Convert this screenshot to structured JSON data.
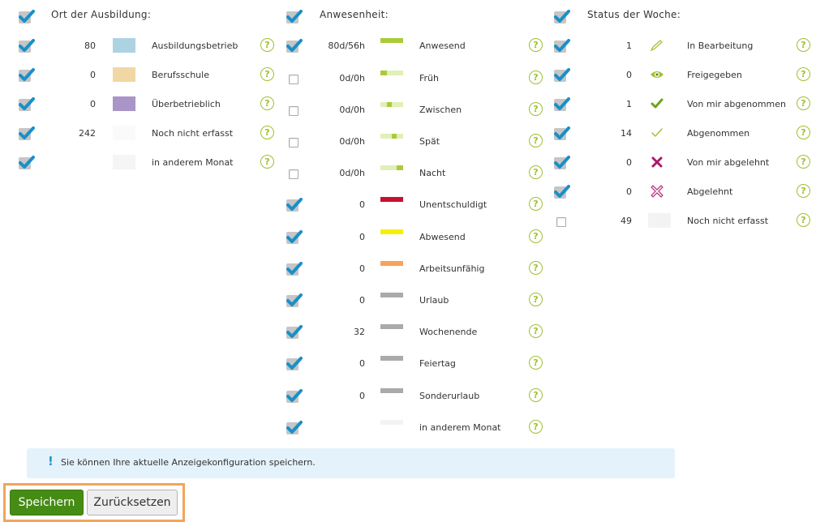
{
  "ausbildung": {
    "heading": "Ort der Ausbildung:",
    "items": [
      {
        "count": "80",
        "label": "Ausbildungsbetrieb",
        "color": "#add3e3"
      },
      {
        "count": "0",
        "label": "Berufsschule",
        "color": "#f1d7a4"
      },
      {
        "count": "0",
        "label": "Überbetrieblich",
        "color": "#a995c7"
      },
      {
        "count": "242",
        "label": "Noch nicht erfasst",
        "color": "#fafafa"
      },
      {
        "count": "",
        "label": "in anderem Monat",
        "color": "#f5f5f5"
      }
    ]
  },
  "anwesenheit": {
    "heading": "Anwesenheit:",
    "items": [
      {
        "count": "80d/56h",
        "label": "Anwesend",
        "checked": true,
        "icon": "bar-full-green"
      },
      {
        "count": "0d/0h",
        "label": "Früh",
        "checked": false,
        "icon": "bar-early"
      },
      {
        "count": "0d/0h",
        "label": "Zwischen",
        "checked": false,
        "icon": "bar-middle"
      },
      {
        "count": "0d/0h",
        "label": "Spät",
        "checked": false,
        "icon": "bar-late"
      },
      {
        "count": "0d/0h",
        "label": "Nacht",
        "checked": false,
        "icon": "bar-night"
      },
      {
        "count": "0",
        "label": "Unentschuldigt",
        "checked": true,
        "icon": "bar-red"
      },
      {
        "count": "0",
        "label": "Abwesend",
        "checked": true,
        "icon": "bar-yellow"
      },
      {
        "count": "0",
        "label": "Arbeitsunfähig",
        "checked": true,
        "icon": "bar-orange"
      },
      {
        "count": "0",
        "label": "Urlaub",
        "checked": true,
        "icon": "bar-gray"
      },
      {
        "count": "32",
        "label": "Wochenende",
        "checked": true,
        "icon": "bar-gray"
      },
      {
        "count": "0",
        "label": "Feiertag",
        "checked": true,
        "icon": "bar-gray"
      },
      {
        "count": "0",
        "label": "Sonderurlaub",
        "checked": true,
        "icon": "bar-gray"
      },
      {
        "count": "",
        "label": "in anderem Monat",
        "checked": true,
        "icon": "bar-faint"
      }
    ]
  },
  "status": {
    "heading": "Status der Woche:",
    "items": [
      {
        "count": "1",
        "label": "In Bearbeitung",
        "checked": true,
        "icon": "pencil-icon"
      },
      {
        "count": "0",
        "label": "Freigegeben",
        "checked": true,
        "icon": "eye-icon"
      },
      {
        "count": "1",
        "label": "Von mir abgenommen",
        "checked": true,
        "icon": "check-bold-icon"
      },
      {
        "count": "14",
        "label": "Abgenommen",
        "checked": true,
        "icon": "check-thin-icon"
      },
      {
        "count": "0",
        "label": "Von mir abgelehnt",
        "checked": true,
        "icon": "cross-bold-icon"
      },
      {
        "count": "0",
        "label": "Abgelehnt",
        "checked": true,
        "icon": "cross-outline-icon"
      },
      {
        "count": "49",
        "label": "Noch nicht erfasst",
        "checked": false,
        "icon": "gray-swatch"
      }
    ]
  },
  "help_glyph": "?",
  "info": {
    "icon": "!",
    "text": "Sie können Ihre aktuelle Anzeigekonfiguration speichern."
  },
  "buttons": {
    "save": "Speichern",
    "reset": "Zurücksetzen"
  },
  "colors": {
    "accent_green": "#9dc12f",
    "check_blue": "#1a8fc9",
    "primary_button": "#458c14",
    "highlight_border": "#f1a55c",
    "info_bg": "#e4f2fb"
  }
}
